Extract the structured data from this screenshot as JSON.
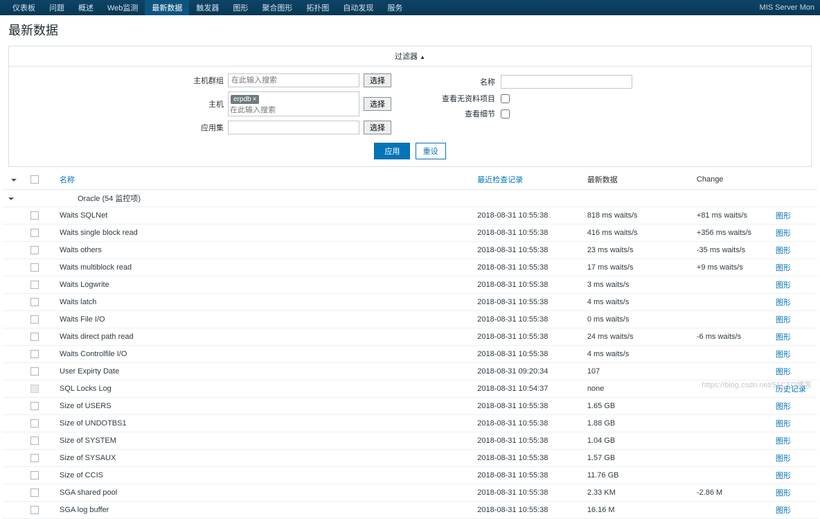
{
  "brand": "MIS Server Mon",
  "nav": [
    "仪表板",
    "问题",
    "概述",
    "Web监测",
    "最新数据",
    "触发器",
    "图形",
    "聚合图形",
    "拓扑图",
    "自动发现",
    "服务"
  ],
  "nav_active": 4,
  "page_title": "最新数据",
  "filter": {
    "header": "过滤器",
    "arrow": "▲",
    "host_group_label": "主机群组",
    "host_label": "主机",
    "app_label": "应用集",
    "search_placeholder": "在此输入搜索",
    "select_btn": "选择",
    "host_tag": "erpdb",
    "name_label": "名称",
    "no_data_label": "查看无资料项目",
    "detail_label": "查看细节",
    "apply_btn": "应用",
    "reset_btn": "重设"
  },
  "table": {
    "headers": {
      "name": "名称",
      "lastcheck": "最近检查记录",
      "lastdata": "最新数据",
      "change": "Change"
    },
    "group": "Oracle (54 监控项)",
    "graph_link": "图形",
    "history_link": "历史记录",
    "rows": [
      {
        "name": "Waits SQLNet",
        "time": "2018-08-31 10:55:38",
        "data": "818 ms waits/s",
        "change": "+81 ms waits/s",
        "link": "graph",
        "disabled": false
      },
      {
        "name": "Waits single block read",
        "time": "2018-08-31 10:55:38",
        "data": "416 ms waits/s",
        "change": "+356 ms waits/s",
        "link": "graph",
        "disabled": false
      },
      {
        "name": "Waits others",
        "time": "2018-08-31 10:55:38",
        "data": "23 ms waits/s",
        "change": "-35 ms waits/s",
        "link": "graph",
        "disabled": false
      },
      {
        "name": "Waits multiblock read",
        "time": "2018-08-31 10:55:38",
        "data": "17 ms waits/s",
        "change": "+9 ms waits/s",
        "link": "graph",
        "disabled": false
      },
      {
        "name": "Waits Logwrite",
        "time": "2018-08-31 10:55:38",
        "data": "3 ms waits/s",
        "change": "",
        "link": "graph",
        "disabled": false
      },
      {
        "name": "Waits latch",
        "time": "2018-08-31 10:55:38",
        "data": "4 ms waits/s",
        "change": "",
        "link": "graph",
        "disabled": false
      },
      {
        "name": "Waits File I/O",
        "time": "2018-08-31 10:55:38",
        "data": "0 ms waits/s",
        "change": "",
        "link": "graph",
        "disabled": false
      },
      {
        "name": "Waits direct path read",
        "time": "2018-08-31 10:55:38",
        "data": "24 ms waits/s",
        "change": "-6 ms waits/s",
        "link": "graph",
        "disabled": false
      },
      {
        "name": "Waits Controlfile I/O",
        "time": "2018-08-31 10:55:38",
        "data": "4 ms waits/s",
        "change": "",
        "link": "graph",
        "disabled": false
      },
      {
        "name": "User Expirty Date",
        "time": "2018-08-31 09:20:34",
        "data": "107",
        "change": "",
        "link": "graph",
        "disabled": false
      },
      {
        "name": "SQL Locks Log",
        "time": "2018-08-31 10:54:37",
        "data": "none",
        "change": "",
        "link": "history",
        "disabled": true
      },
      {
        "name": "Size of USERS",
        "time": "2018-08-31 10:55:38",
        "data": "1.65 GB",
        "change": "",
        "link": "graph",
        "disabled": false
      },
      {
        "name": "Size of UNDOTBS1",
        "time": "2018-08-31 10:55:38",
        "data": "1.88 GB",
        "change": "",
        "link": "graph",
        "disabled": false
      },
      {
        "name": "Size of SYSTEM",
        "time": "2018-08-31 10:55:38",
        "data": "1.04 GB",
        "change": "",
        "link": "graph",
        "disabled": false
      },
      {
        "name": "Size of SYSAUX",
        "time": "2018-08-31 10:55:38",
        "data": "1.57 GB",
        "change": "",
        "link": "graph",
        "disabled": false
      },
      {
        "name": "Size of CCIS",
        "time": "2018-08-31 10:55:38",
        "data": "11.76 GB",
        "change": "",
        "link": "graph",
        "disabled": false
      },
      {
        "name": "SGA shared pool",
        "time": "2018-08-31 10:55:38",
        "data": "2.33 KM",
        "change": "-2.86 M",
        "link": "graph",
        "disabled": false
      },
      {
        "name": "SGA log buffer",
        "time": "2018-08-31 10:55:38",
        "data": "16.16 M",
        "change": "",
        "link": "graph",
        "disabled": false
      }
    ]
  },
  "watermark": "https://blog.csdn.net/51CTO博客"
}
